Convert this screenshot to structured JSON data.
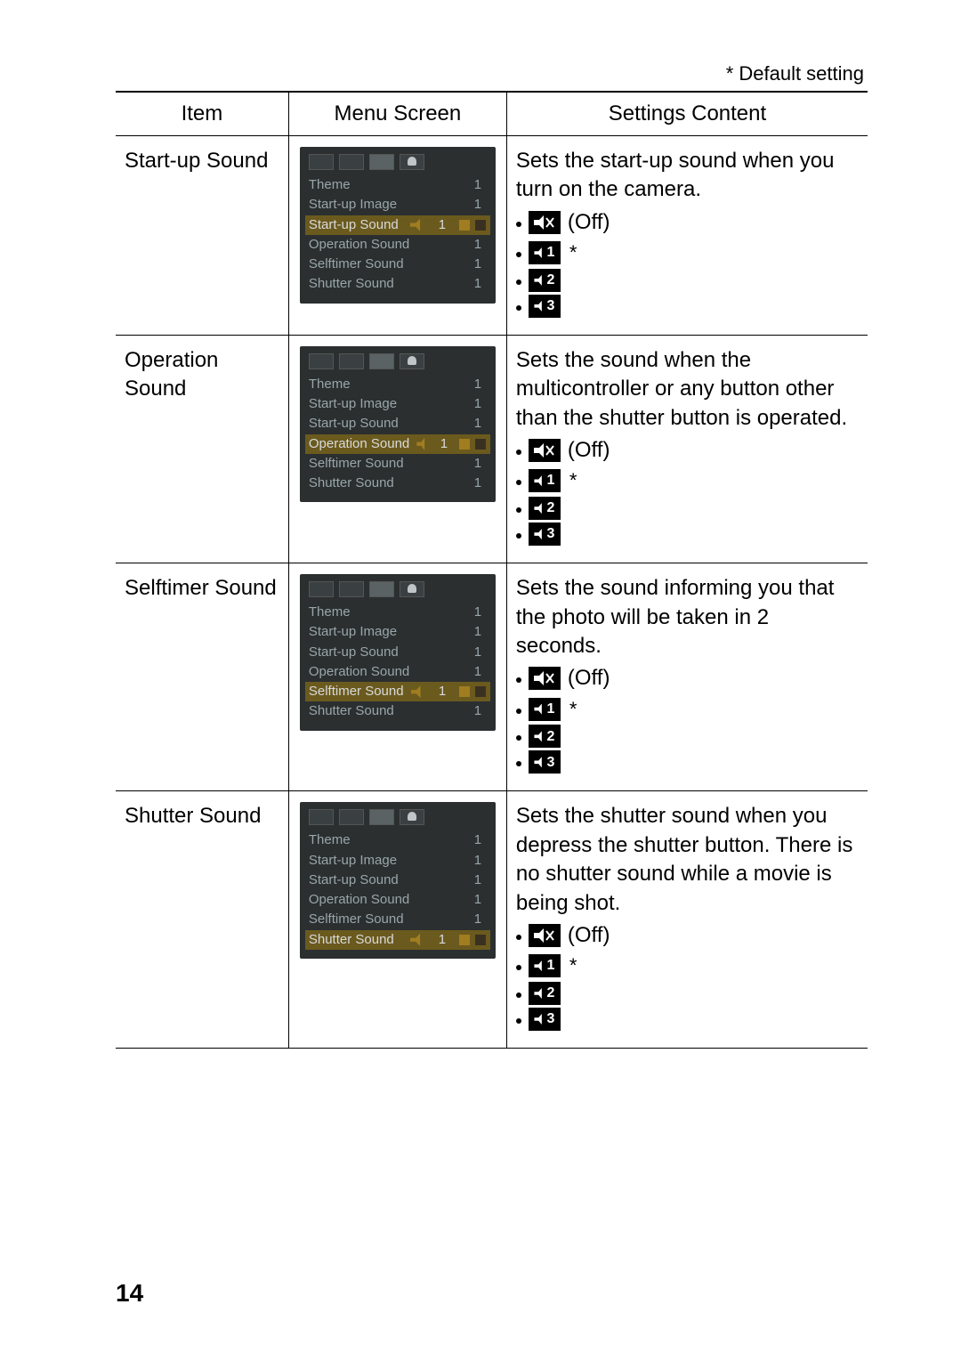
{
  "default_note": "* Default setting",
  "headers": {
    "item": "Item",
    "menu": "Menu Screen",
    "settings": "Settings Content"
  },
  "off_label": "(Off)",
  "star": "*",
  "lcd_menu": {
    "theme": "Theme",
    "startup_image": "Start-up Image",
    "startup_sound": "Start-up Sound",
    "operation_sound": "Operation Sound",
    "selftimer_sound": "Selftimer Sound",
    "shutter_sound": "Shutter Sound",
    "val1": "1"
  },
  "rows": [
    {
      "item": "Start-up Sound",
      "desc": "Sets the start-up sound when you turn on the camera.",
      "hl_index": 2
    },
    {
      "item": "Operation Sound",
      "desc": "Sets the sound when the multicontroller or any button other than the shutter button is operated.",
      "hl_index": 3
    },
    {
      "item": "Selftimer Sound",
      "desc": "Sets the sound informing you that the photo will be taken in 2 seconds.",
      "hl_index": 4
    },
    {
      "item": "Shutter Sound",
      "desc": "Sets the shutter sound when you depress the shutter button. There is no shutter sound while a movie is being shot.",
      "hl_index": 5
    }
  ],
  "page_number": "14"
}
